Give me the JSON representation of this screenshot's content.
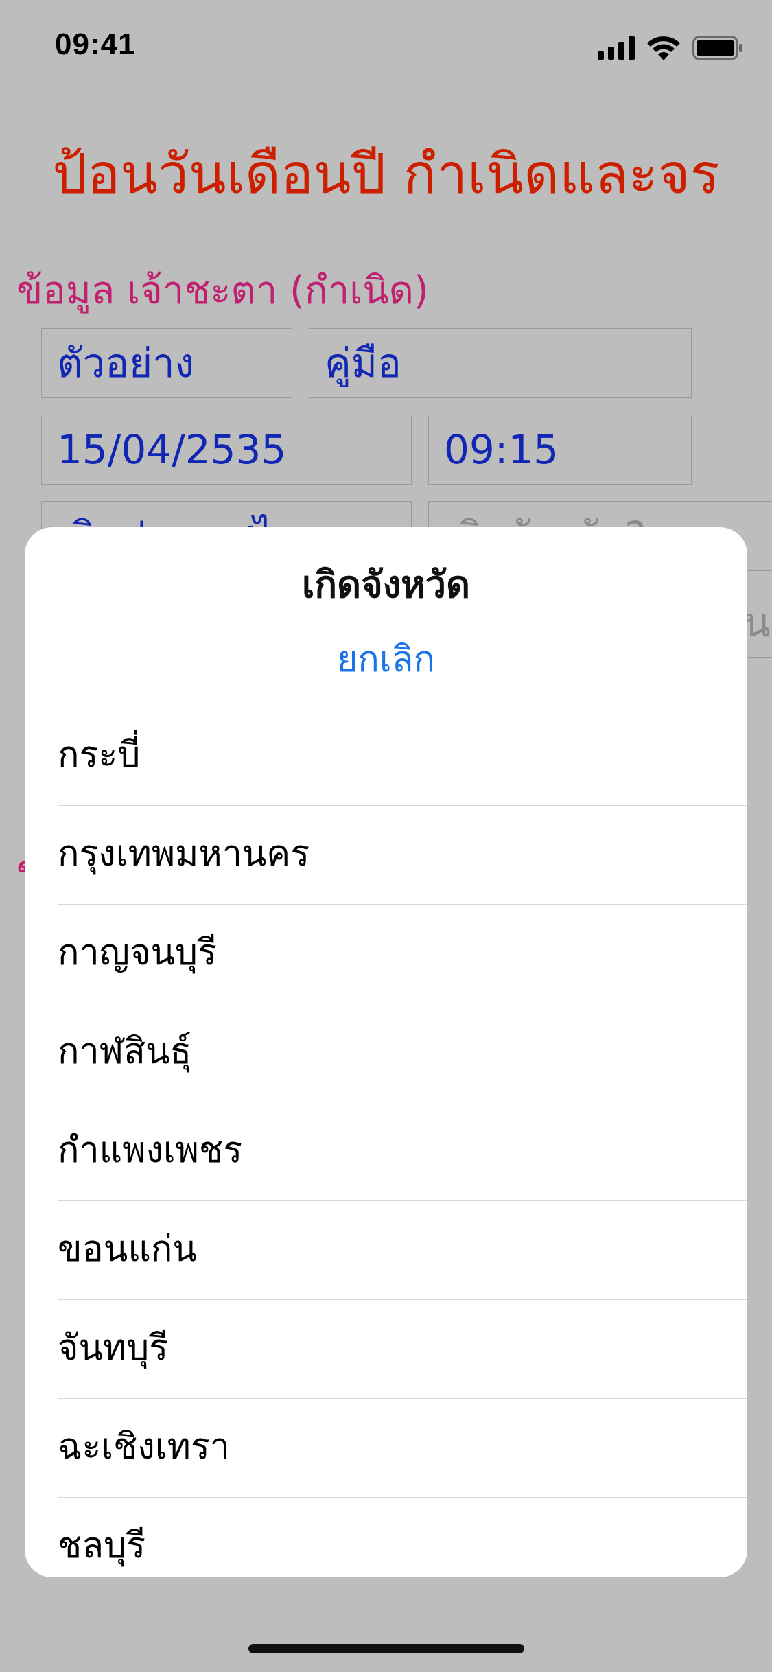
{
  "status_bar": {
    "time": "09:41",
    "icons": [
      "cellular-signal-icon",
      "wifi-icon",
      "battery-icon"
    ]
  },
  "background_form": {
    "title": "ป้อนวันเดือนปี กำเนิดและจร",
    "section_birth_label": "ข้อมูล เจ้าชะตา (กำเนิด)",
    "section_second_label_fragment": "ข",
    "fields": {
      "sample_button": "ตัวอย่าง",
      "manual_button": "คู่มือ",
      "birth_date": "15/04/2535",
      "birth_time": "09:15",
      "country_partial": "เกิดประเทศไทย",
      "province_placeholder_partial": "เกิดจังหวัด?",
      "side_field_fragment": "น"
    },
    "colors": {
      "title": "#cc1f00",
      "section_label": "#c0206f",
      "field_text": "#1126b3"
    }
  },
  "action_sheet": {
    "title": "เกิดจังหวัด",
    "cancel_label": "ยกเลิก",
    "provinces": [
      "กระบี่",
      "กรุงเทพมหานคร",
      "กาญจนบุรี",
      "กาฬสินธุ์",
      "กำแพงเพชร",
      "ขอนแก่น",
      "จันทบุรี",
      "ฉะเชิงเทรา",
      "ชลบุรี"
    ],
    "colors": {
      "cancel": "#1a73e8"
    }
  }
}
